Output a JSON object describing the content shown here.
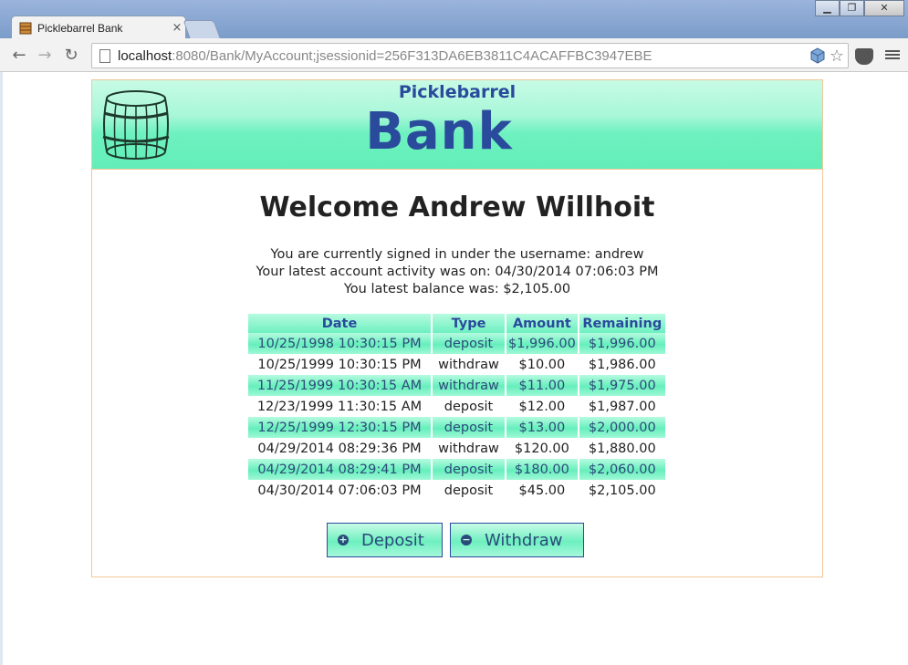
{
  "browser": {
    "tab_title": "Picklebarrel Bank",
    "tab_close": "×",
    "url_host": "localhost",
    "url_rest": ":8080/Bank/MyAccount;jsessionid=256F313DA6EB3811C4ACAFFBC3947EBE",
    "back": "←",
    "forward": "→",
    "reload": "↻",
    "window_minimize": "▁",
    "window_restore": "❐",
    "window_close": "✕",
    "star": "☆"
  },
  "banner": {
    "small": "Picklebarrel",
    "big": "Bank"
  },
  "welcome": "Welcome Andrew Willhoit",
  "info": {
    "line1": "You are currently signed in under the username: andrew",
    "line2": "Your latest account activity was on: 04/30/2014 07:06:03 PM",
    "line3": "You latest balance was: $2,105.00"
  },
  "table": {
    "headers": [
      "Date",
      "Type",
      "Amount",
      "Remaining"
    ],
    "rows": [
      [
        "10/25/1998 10:30:15 PM",
        "deposit",
        "$1,996.00",
        "$1,996.00"
      ],
      [
        "10/25/1999 10:30:15 PM",
        "withdraw",
        "$10.00",
        "$1,986.00"
      ],
      [
        "11/25/1999 10:30:15 AM",
        "withdraw",
        "$11.00",
        "$1,975.00"
      ],
      [
        "12/23/1999 11:30:15 AM",
        "deposit",
        "$12.00",
        "$1,987.00"
      ],
      [
        "12/25/1999 12:30:15 PM",
        "deposit",
        "$13.00",
        "$2,000.00"
      ],
      [
        "04/29/2014 08:29:36 PM",
        "withdraw",
        "$120.00",
        "$1,880.00"
      ],
      [
        "04/29/2014 08:29:41 PM",
        "deposit",
        "$180.00",
        "$2,060.00"
      ],
      [
        "04/30/2014 07:06:03 PM",
        "deposit",
        "$45.00",
        "$2,105.00"
      ]
    ]
  },
  "buttons": {
    "deposit": "Deposit",
    "deposit_icon": "+",
    "withdraw": "Withdraw",
    "withdraw_icon": "−"
  },
  "colors": {
    "brand": "#2a4a9c",
    "mint": "#6ef0c0",
    "border": "#f0c896"
  }
}
